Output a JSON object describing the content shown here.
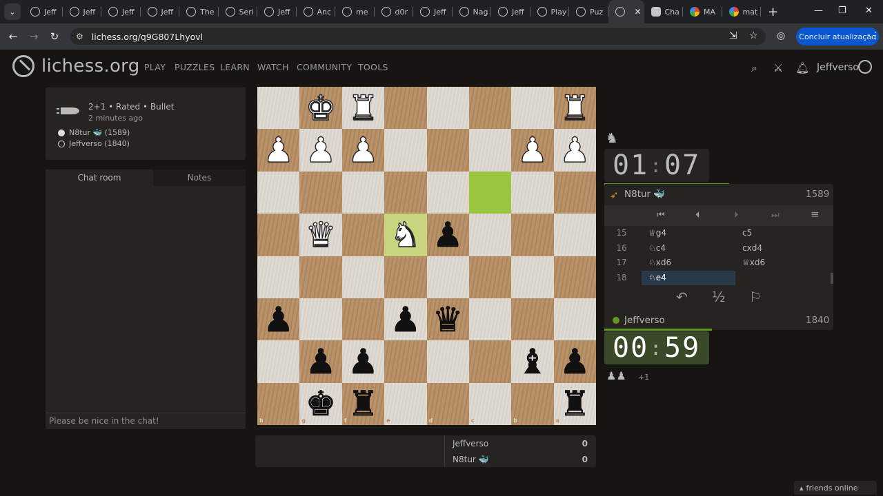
{
  "browser": {
    "tabs": [
      {
        "label": "Jeff",
        "favicon": "lichess-icon"
      },
      {
        "label": "Jeff",
        "favicon": "lichess-icon"
      },
      {
        "label": "Jeff",
        "favicon": "lichess-icon"
      },
      {
        "label": "Jeff",
        "favicon": "lichess-icon"
      },
      {
        "label": "The",
        "favicon": "lichess-icon"
      },
      {
        "label": "Seri",
        "favicon": "lichess-icon"
      },
      {
        "label": "Jeff",
        "favicon": "lichess-icon"
      },
      {
        "label": "Anc",
        "favicon": "lichess-icon"
      },
      {
        "label": "me",
        "favicon": "lichess-icon"
      },
      {
        "label": "d0r",
        "favicon": "lichess-icon"
      },
      {
        "label": "Jeff",
        "favicon": "lichess-icon"
      },
      {
        "label": "Nag",
        "favicon": "lichess-icon"
      },
      {
        "label": "Jeff",
        "favicon": "lichess-icon"
      },
      {
        "label": "Play",
        "favicon": "lichess-icon"
      },
      {
        "label": "Puz",
        "favicon": "lichess-icon"
      }
    ],
    "active_tab_close": "✕",
    "tabs_after": [
      {
        "label": "Cha",
        "favicon": "chatgpt-icon"
      },
      {
        "label": "MA",
        "favicon": "google-icon"
      },
      {
        "label": "mat",
        "favicon": "google-icon"
      }
    ],
    "url": "lichess.org/q9G807Lhyovl",
    "update_button": "Concluir atualização"
  },
  "site": {
    "logo_text": "lichess.org",
    "menu": [
      "PLAY",
      "PUZZLES",
      "LEARN",
      "WATCH",
      "COMMUNITY",
      "TOOLS"
    ],
    "username": "Jeffverso"
  },
  "game_info": {
    "setup": "2+1 • Rated • Bullet",
    "time_ago": "2 minutes ago",
    "black_player": "N8tur 🐳 (1589)",
    "white_player": "Jeffverso (1840)"
  },
  "chat": {
    "tab_chat": "Chat room",
    "tab_notes": "Notes",
    "placeholder": "Please be nice in the chat!"
  },
  "board": {
    "orientation": "black",
    "files_bottom": [
      "h",
      "g",
      "f",
      "e",
      "d",
      "c",
      "b",
      "a"
    ],
    "ranks_right": [
      "1",
      "2",
      "3",
      "4",
      "5",
      "6",
      "7",
      "8"
    ],
    "pieces": [
      {
        "square": "g1",
        "piece": "K",
        "color": "w"
      },
      {
        "square": "f1",
        "piece": "R",
        "color": "w"
      },
      {
        "square": "a1",
        "piece": "R",
        "color": "w"
      },
      {
        "square": "h2",
        "piece": "P",
        "color": "w"
      },
      {
        "square": "g2",
        "piece": "P",
        "color": "w"
      },
      {
        "square": "f2",
        "piece": "P",
        "color": "w"
      },
      {
        "square": "b2",
        "piece": "P",
        "color": "w"
      },
      {
        "square": "a2",
        "piece": "P",
        "color": "w"
      },
      {
        "square": "g4",
        "piece": "Q",
        "color": "w"
      },
      {
        "square": "e4",
        "piece": "N",
        "color": "w"
      },
      {
        "square": "d4",
        "piece": "P",
        "color": "b"
      },
      {
        "square": "h6",
        "piece": "P",
        "color": "b"
      },
      {
        "square": "e6",
        "piece": "P",
        "color": "b"
      },
      {
        "square": "d6",
        "piece": "Q",
        "color": "b"
      },
      {
        "square": "g7",
        "piece": "P",
        "color": "b"
      },
      {
        "square": "f7",
        "piece": "P",
        "color": "b"
      },
      {
        "square": "b7",
        "piece": "B",
        "color": "b"
      },
      {
        "square": "a7",
        "piece": "P",
        "color": "b"
      },
      {
        "square": "g8",
        "piece": "K",
        "color": "b"
      },
      {
        "square": "f8",
        "piece": "R",
        "color": "b"
      },
      {
        "square": "a8",
        "piece": "R",
        "color": "b"
      }
    ],
    "last_move": [
      "c3",
      "e4"
    ]
  },
  "clocks": {
    "top": {
      "minutes": "01",
      "seconds": "07",
      "remaining_fraction": 0.78
    },
    "bottom": {
      "minutes": "00",
      "seconds": "59",
      "remaining_fraction": 0.69
    }
  },
  "players": {
    "top": {
      "name": "N8tur 🐳",
      "rating": "1589"
    },
    "bottom": {
      "name": "Jeffverso",
      "rating": "1840"
    },
    "material_diff": "+1"
  },
  "moves": [
    {
      "num": "15",
      "white": "♕g4",
      "black": "c5"
    },
    {
      "num": "16",
      "white": "♘c4",
      "black": "cxd4"
    },
    {
      "num": "17",
      "white": "♘xd6",
      "black": "♕xd6"
    },
    {
      "num": "18",
      "white": "♘e4",
      "black": ""
    }
  ],
  "actions": {
    "draw": "½"
  },
  "crosstable": [
    {
      "name": "Jeffverso",
      "score": "0"
    },
    {
      "name": "N8tur 🐳",
      "score": "0"
    }
  ],
  "friends": "friends online",
  "colors": {
    "accent_green": "#629924",
    "active_move": "#293a49",
    "update_button": "#0b57d0"
  }
}
